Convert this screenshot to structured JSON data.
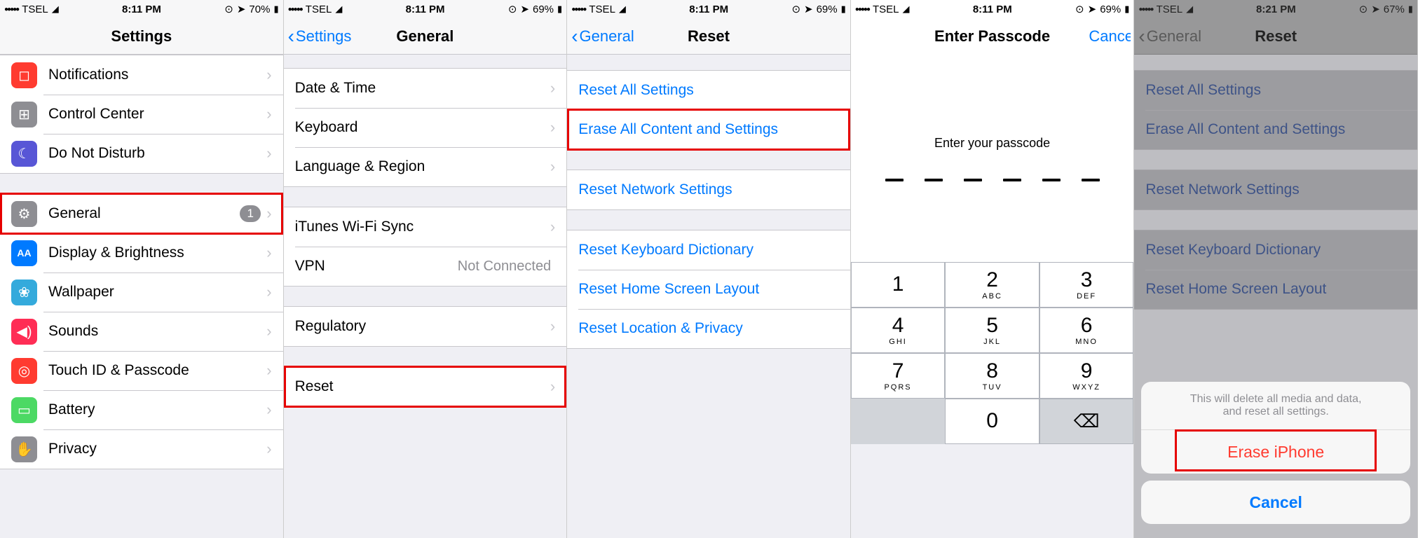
{
  "screens": [
    {
      "status": {
        "carrier": "TSEL",
        "time": "8:11 PM",
        "battery": "70%"
      },
      "title": "Settings",
      "groups": [
        {
          "rows": [
            {
              "icon": "notif",
              "bg": "bg-red",
              "label": "Notifications"
            },
            {
              "icon": "cc",
              "bg": "bg-gray",
              "label": "Control Center"
            },
            {
              "icon": "moon",
              "bg": "bg-purple",
              "label": "Do Not Disturb"
            }
          ]
        },
        {
          "rows": [
            {
              "icon": "gear",
              "bg": "bg-gray",
              "label": "General",
              "badge": "1",
              "hl": true
            },
            {
              "icon": "aa",
              "bg": "bg-blue",
              "label": "Display & Brightness"
            },
            {
              "icon": "wall",
              "bg": "bg-cyan",
              "label": "Wallpaper"
            },
            {
              "icon": "sound",
              "bg": "bg-pink",
              "label": "Sounds"
            },
            {
              "icon": "touch",
              "bg": "bg-red",
              "label": "Touch ID & Passcode"
            },
            {
              "icon": "batt",
              "bg": "bg-green",
              "label": "Battery"
            },
            {
              "icon": "hand",
              "bg": "bg-dgray",
              "label": "Privacy"
            }
          ]
        }
      ]
    },
    {
      "status": {
        "carrier": "TSEL",
        "time": "8:11 PM",
        "battery": "69%"
      },
      "back": "Settings",
      "title": "General",
      "groups": [
        {
          "rows": [
            {
              "label": "Date & Time"
            },
            {
              "label": "Keyboard"
            },
            {
              "label": "Language & Region"
            }
          ]
        },
        {
          "rows": [
            {
              "label": "iTunes Wi-Fi Sync"
            },
            {
              "label": "VPN",
              "detail": "Not Connected"
            }
          ]
        },
        {
          "rows": [
            {
              "label": "Regulatory"
            }
          ]
        },
        {
          "rows": [
            {
              "label": "Reset",
              "hl": true
            }
          ]
        }
      ]
    },
    {
      "status": {
        "carrier": "TSEL",
        "time": "8:11 PM",
        "battery": "69%"
      },
      "back": "General",
      "title": "Reset",
      "groups": [
        {
          "rows": [
            {
              "label": "Reset All Settings",
              "blue": true
            },
            {
              "label": "Erase All Content and Settings",
              "blue": true,
              "hl": true
            }
          ]
        },
        {
          "rows": [
            {
              "label": "Reset Network Settings",
              "blue": true
            }
          ]
        },
        {
          "rows": [
            {
              "label": "Reset Keyboard Dictionary",
              "blue": true
            },
            {
              "label": "Reset Home Screen Layout",
              "blue": true
            },
            {
              "label": "Reset Location & Privacy",
              "blue": true
            }
          ]
        }
      ]
    },
    {
      "status": {
        "carrier": "TSEL",
        "time": "8:11 PM",
        "battery": "69%"
      },
      "title": "Enter Passcode",
      "cancel": "Cancel",
      "prompt": "Enter your passcode",
      "keys": [
        {
          "n": "1",
          "s": ""
        },
        {
          "n": "2",
          "s": "ABC"
        },
        {
          "n": "3",
          "s": "DEF"
        },
        {
          "n": "4",
          "s": "GHI"
        },
        {
          "n": "5",
          "s": "JKL"
        },
        {
          "n": "6",
          "s": "MNO"
        },
        {
          "n": "7",
          "s": "PQRS"
        },
        {
          "n": "8",
          "s": "TUV"
        },
        {
          "n": "9",
          "s": "WXYZ"
        },
        {
          "blank": true
        },
        {
          "n": "0",
          "s": ""
        },
        {
          "del": true
        }
      ]
    },
    {
      "status": {
        "carrier": "TSEL",
        "time": "8:21 PM",
        "battery": "67%"
      },
      "back": "General",
      "title": "Reset",
      "dim": true,
      "groups": [
        {
          "rows": [
            {
              "label": "Reset All Settings",
              "blue": true
            },
            {
              "label": "Erase All Content and Settings",
              "blue": true
            }
          ]
        },
        {
          "rows": [
            {
              "label": "Reset Network Settings",
              "blue": true
            }
          ]
        },
        {
          "rows": [
            {
              "label": "Reset Keyboard Dictionary",
              "blue": true
            },
            {
              "label": "Reset Home Screen Layout",
              "blue": true
            }
          ]
        }
      ],
      "sheet": {
        "msg1": "This will delete all media and data,",
        "msg2": "and reset all settings.",
        "action": "Erase iPhone",
        "cancel": "Cancel"
      }
    }
  ],
  "icons": {
    "notif": "◻",
    "cc": "⊞",
    "moon": "☾",
    "gear": "⚙",
    "aa": "AA",
    "wall": "❀",
    "sound": "◀)",
    "touch": "◎",
    "batt": "▭",
    "hand": "✋"
  }
}
